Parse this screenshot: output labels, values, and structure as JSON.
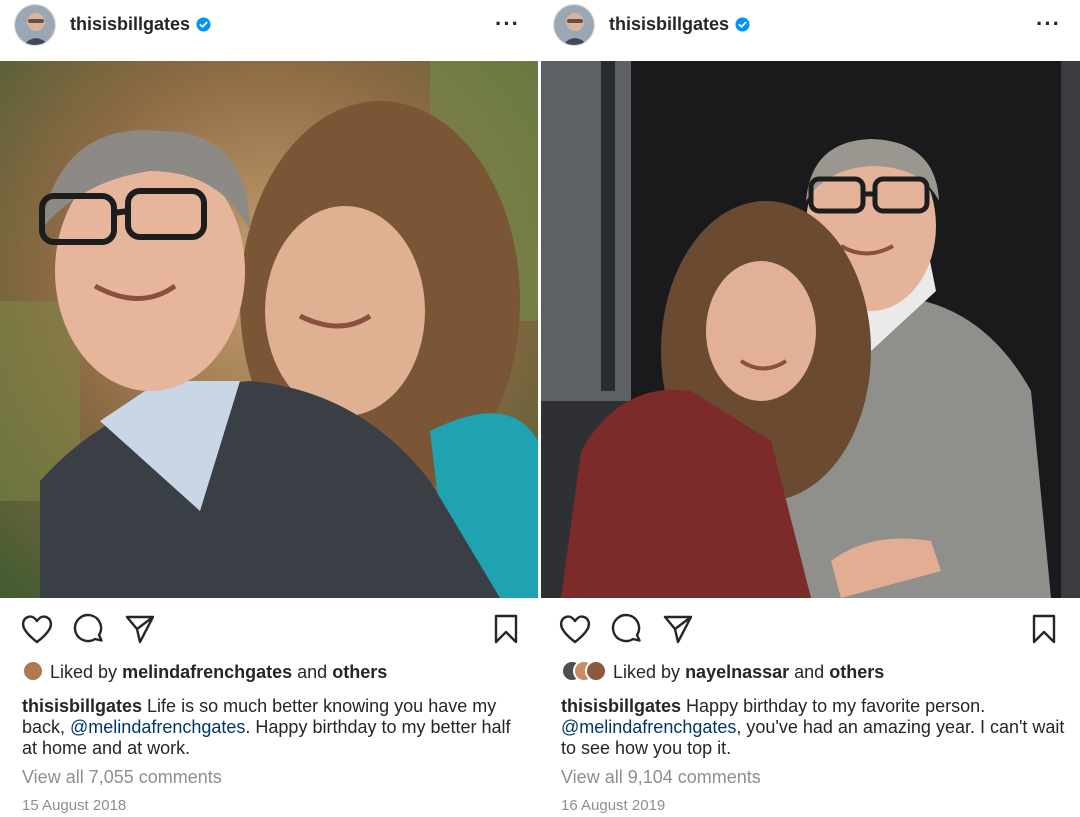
{
  "posts": [
    {
      "username": "thisisbillgates",
      "liked_prefix": "Liked by",
      "liked_user": "melindafrenchgates",
      "liked_and": "and",
      "liked_others": "others",
      "caption_user": "thisisbillgates",
      "caption_text_1": " Life is so much better knowing you have my back, ",
      "caption_mention": "@melindafrenchgates",
      "caption_text_2": ". Happy birthday to my better half at home and at work.",
      "comments_link": "View all 7,055 comments",
      "date": "15 August 2018"
    },
    {
      "username": "thisisbillgates",
      "liked_prefix": "Liked by",
      "liked_user": "nayelnassar",
      "liked_and": "and",
      "liked_others": "others",
      "caption_user": "thisisbillgates",
      "caption_text_1": " Happy birthday to my favorite person. ",
      "caption_mention": "@melindafrenchgates",
      "caption_text_2": ", you've had an amazing year. I can't wait to see how you top it.",
      "comments_link": "View all 9,104 comments",
      "date": "16 August 2019"
    }
  ],
  "icons": {
    "verified": "verified-badge-icon",
    "more": "more-options-icon",
    "like": "heart-icon",
    "comment": "comment-icon",
    "share": "paper-plane-icon",
    "save": "bookmark-icon"
  },
  "colors": {
    "verified": "#0095f6",
    "mention": "#00376b",
    "muted": "#8e8e8e",
    "text": "#262626"
  }
}
